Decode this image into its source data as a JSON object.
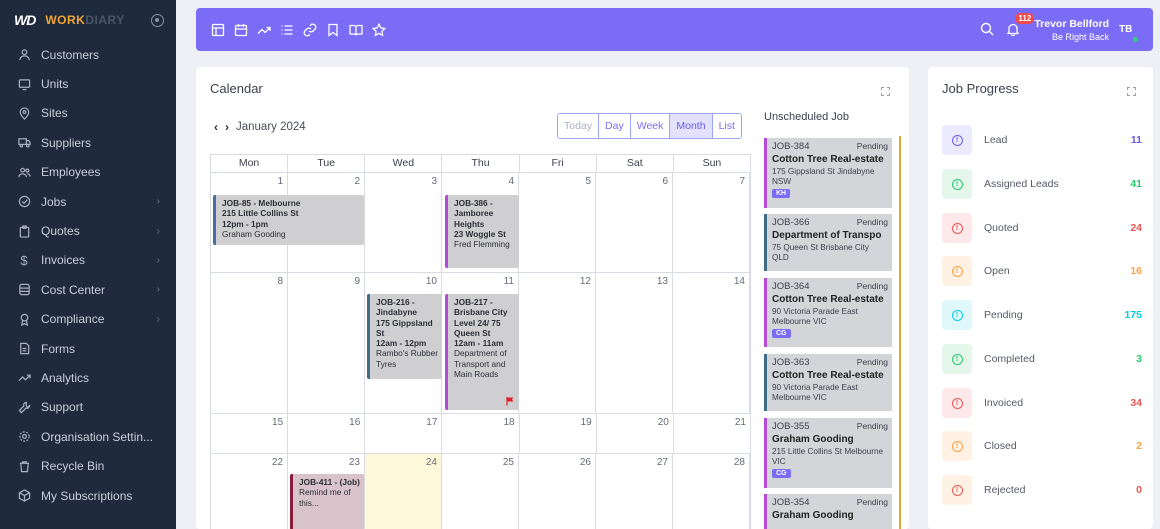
{
  "brand": {
    "mark": "WD",
    "name_primary": "WORK",
    "name_secondary": "DIARY"
  },
  "sidebar": {
    "items": [
      {
        "label": "Customers",
        "icon": "user-icon",
        "chevron": false
      },
      {
        "label": "Units",
        "icon": "monitor-icon",
        "chevron": false
      },
      {
        "label": "Sites",
        "icon": "location-pin-icon",
        "chevron": false
      },
      {
        "label": "Suppliers",
        "icon": "truck-icon",
        "chevron": false
      },
      {
        "label": "Employees",
        "icon": "users-icon",
        "chevron": false
      },
      {
        "label": "Jobs",
        "icon": "check-circle-icon",
        "chevron": true
      },
      {
        "label": "Quotes",
        "icon": "clipboard-icon",
        "chevron": true
      },
      {
        "label": "Invoices",
        "icon": "dollar-icon",
        "chevron": true
      },
      {
        "label": "Cost Center",
        "icon": "database-icon",
        "chevron": true
      },
      {
        "label": "Compliance",
        "icon": "award-icon",
        "chevron": true
      },
      {
        "label": "Forms",
        "icon": "form-icon",
        "chevron": false
      },
      {
        "label": "Analytics",
        "icon": "trend-icon",
        "chevron": false
      },
      {
        "label": "Support",
        "icon": "wrench-icon",
        "chevron": false
      },
      {
        "label": "Organisation Settin...",
        "icon": "gear-icon",
        "chevron": false
      },
      {
        "label": "Recycle Bin",
        "icon": "trash-icon",
        "chevron": false
      },
      {
        "label": "My Subscriptions",
        "icon": "package-icon",
        "chevron": false
      }
    ]
  },
  "topbar": {
    "notification_count": "112",
    "user_name": "Trevor Bellford",
    "user_status": "Be Right Back",
    "user_initials": "TB"
  },
  "calendar": {
    "title": "Calendar",
    "month_label": "January 2024",
    "views": [
      "Today",
      "Day",
      "Week",
      "Month",
      "List"
    ],
    "active_view": "Month",
    "weekdays": [
      "Mon",
      "Tue",
      "Wed",
      "Thu",
      "Fri",
      "Sat",
      "Sun"
    ],
    "weeks": [
      [
        "1",
        "2",
        "3",
        "4",
        "5",
        "6",
        "7"
      ],
      [
        "8",
        "9",
        "10",
        "11",
        "12",
        "13",
        "14"
      ],
      [
        "15",
        "16",
        "17",
        "18",
        "19",
        "20",
        "21"
      ],
      [
        "22",
        "23",
        "24",
        "25",
        "26",
        "27",
        "28"
      ]
    ],
    "events": {
      "job85": {
        "title": "JOB-85 - Melbourne",
        "addr": "215 Little Collins St",
        "time": "12pm - 1pm",
        "client": "Graham Gooding"
      },
      "job386": {
        "title": "JOB-386 - Jamboree Heights",
        "addr": "23 Woggle St",
        "client": "Fred Flemming"
      },
      "job216": {
        "title": "JOB-216 - Jindabyne",
        "addr": "175 Gippsland St",
        "time": "12am - 12pm",
        "client": "Rambo's Rubber Tyres"
      },
      "job217": {
        "title": "JOB-217 - Brisbane City",
        "addr": "Level 24/ 75 Queen St",
        "time": "12am - 11am",
        "client": "Department of Transport and Main Roads"
      },
      "job411": {
        "title": "JOB-411 - (Job)",
        "note": "Remind me of this..."
      }
    }
  },
  "unscheduled": {
    "title": "Unscheduled Job",
    "jobs": [
      {
        "id": "JOB-384",
        "status": "Pending",
        "client": "Cotton Tree Real-estate",
        "addr": "175 Gippsland St Jindabyne NSW",
        "tag": "KH"
      },
      {
        "id": "JOB-366",
        "status": "Pending",
        "client": "Department of Transpo",
        "addr": "75 Queen St Brisbane City QLD",
        "tag": ""
      },
      {
        "id": "JOB-364",
        "status": "Pending",
        "client": "Cotton Tree Real-estate",
        "addr": "90 Victoria Parade East Melbourne VIC",
        "tag": "CG"
      },
      {
        "id": "JOB-363",
        "status": "Pending",
        "client": "Cotton Tree Real-estate",
        "addr": "90 Victoria Parade East Melbourne VIC",
        "tag": ""
      },
      {
        "id": "JOB-355",
        "status": "Pending",
        "client": "Graham Gooding",
        "addr": "215 Little Collins St Melbourne VIC",
        "tag": "CG"
      },
      {
        "id": "JOB-354",
        "status": "Pending",
        "client": "Graham Gooding",
        "addr": "",
        "tag": ""
      }
    ]
  },
  "job_progress": {
    "title": "Job Progress",
    "items": [
      {
        "label": "Lead",
        "count": "11",
        "color": "#6c5ce7",
        "bg": "#ecebfd"
      },
      {
        "label": "Assigned Leads",
        "count": "41",
        "color": "#28c76f",
        "bg": "#e4f7ea"
      },
      {
        "label": "Quoted",
        "count": "24",
        "color": "#ea5455",
        "bg": "#fde9e9"
      },
      {
        "label": "Open",
        "count": "16",
        "color": "#ff9f43",
        "bg": "#fff2e4"
      },
      {
        "label": "Pending",
        "count": "175",
        "color": "#00cfe8",
        "bg": "#e0f8fb"
      },
      {
        "label": "Completed",
        "count": "3",
        "color": "#28c76f",
        "bg": "#e4f7ea"
      },
      {
        "label": "Invoiced",
        "count": "34",
        "color": "#ea5455",
        "bg": "#fde9e9"
      },
      {
        "label": "Closed",
        "count": "2",
        "color": "#ff9f43",
        "bg": "#fff2e4"
      },
      {
        "label": "Rejected",
        "count": "0",
        "color": "#ea5455",
        "bg": "#fff2e4"
      }
    ]
  }
}
